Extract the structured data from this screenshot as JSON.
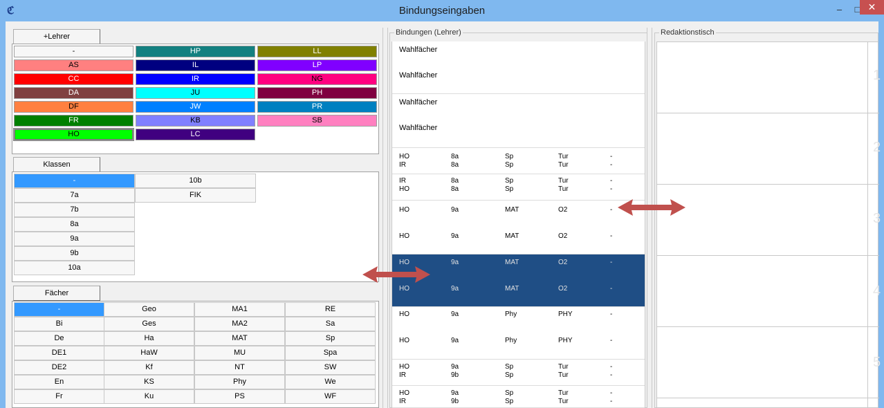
{
  "window": {
    "title": "Bindungseingaben",
    "minimize": "–",
    "maximize": "□",
    "close": "✕"
  },
  "lehrer": {
    "header": "+Lehrer",
    "cells": [
      {
        "label": "-",
        "color": "#f7f7f7",
        "text": "#000"
      },
      {
        "label": "HP",
        "color": "#138080",
        "text": "#fff"
      },
      {
        "label": "LL",
        "color": "#808000",
        "text": "#fff"
      },
      {
        "label": "AS",
        "color": "#ff8080",
        "text": "#000"
      },
      {
        "label": "IL",
        "color": "#000080",
        "text": "#fff"
      },
      {
        "label": "LP",
        "color": "#8000ff",
        "text": "#fff"
      },
      {
        "label": "CC",
        "color": "#ff0000",
        "text": "#fff"
      },
      {
        "label": "IR",
        "color": "#0000ff",
        "text": "#fff"
      },
      {
        "label": "NG",
        "color": "#ff0080",
        "text": "#000"
      },
      {
        "label": "DA",
        "color": "#804040",
        "text": "#fff"
      },
      {
        "label": "JU",
        "color": "#00ffff",
        "text": "#000"
      },
      {
        "label": "PH",
        "color": "#800040",
        "text": "#fff"
      },
      {
        "label": "DF",
        "color": "#ff8040",
        "text": "#000"
      },
      {
        "label": "JW",
        "color": "#0080ff",
        "text": "#fff"
      },
      {
        "label": "PR",
        "color": "#0080c0",
        "text": "#fff"
      },
      {
        "label": "FR",
        "color": "#008000",
        "text": "#fff"
      },
      {
        "label": "KB",
        "color": "#8080ff",
        "text": "#000"
      },
      {
        "label": "SB",
        "color": "#ff80c0",
        "text": "#000"
      },
      {
        "label": "HO",
        "color": "#00ff00",
        "text": "#000"
      },
      {
        "label": "LC",
        "color": "#400080",
        "text": "#fff"
      }
    ]
  },
  "klassen": {
    "header": "Klassen",
    "col1": [
      "-",
      "7a",
      "7b",
      "8a",
      "9a",
      "9b",
      "10a"
    ],
    "col2": [
      "10b",
      "FIK"
    ],
    "selected_color": "#3399ff"
  },
  "faecher": {
    "header": "Fächer",
    "rows": [
      [
        "-",
        "Geo",
        "MA1",
        "RE"
      ],
      [
        "Bi",
        "Ges",
        "MA2",
        "Sa"
      ],
      [
        "De",
        "Ha",
        "MAT",
        "Sp"
      ],
      [
        "DE1",
        "HaW",
        "MU",
        "Spa"
      ],
      [
        "DE2",
        "Kf",
        "NT",
        "SW"
      ],
      [
        "En",
        "KS",
        "Phy",
        "We"
      ],
      [
        "Fr",
        "Ku",
        "PS",
        "WF"
      ]
    ]
  },
  "bindungen": {
    "title": "Bindungen (Lehrer)",
    "wahlfaecher": [
      "Wahlfächer",
      "Wahlfächer",
      "Wahlfächer",
      "Wahlfächer"
    ],
    "rows": [
      [
        "HO",
        "8a",
        "Sp",
        "Tur",
        "-"
      ],
      [
        "IR",
        "8a",
        "Sp",
        "Tur",
        "-"
      ],
      [
        "IR",
        "8a",
        "Sp",
        "Tur",
        "-"
      ],
      [
        "HO",
        "8a",
        "Sp",
        "Tur",
        "-"
      ],
      [
        "HO",
        "9a",
        "MAT",
        "O2",
        "-"
      ],
      [
        "HO",
        "9a",
        "MAT",
        "O2",
        "-"
      ],
      [
        "HO",
        "9a",
        "MAT",
        "O2",
        "-"
      ],
      [
        "HO",
        "9a",
        "MAT",
        "O2",
        "-"
      ],
      [
        "HO",
        "9a",
        "Phy",
        "PHY",
        "-"
      ],
      [
        "HO",
        "9a",
        "Phy",
        "PHY",
        "-"
      ],
      [
        "HO",
        "9a",
        "Sp",
        "Tur",
        "-"
      ],
      [
        "IR",
        "9b",
        "Sp",
        "Tur",
        "-"
      ],
      [
        "HO",
        "9a",
        "Sp",
        "Tur",
        "-"
      ],
      [
        "IR",
        "9b",
        "Sp",
        "Tur",
        "-"
      ]
    ]
  },
  "redaktionstisch": {
    "title": "Redaktionstisch",
    "numbers": [
      "1",
      "2",
      "3",
      "4",
      "5"
    ]
  },
  "colors": {
    "arrow": "#c0504d",
    "selected_row": "#1f4e85"
  }
}
